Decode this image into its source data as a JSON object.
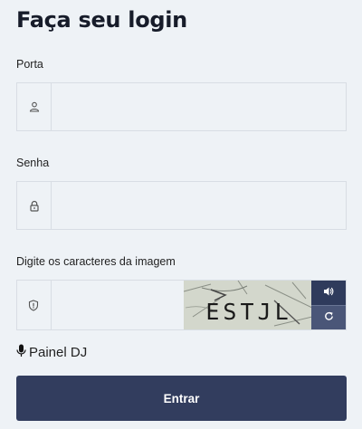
{
  "page": {
    "title": "Faça seu login"
  },
  "form": {
    "port": {
      "label": "Porta",
      "value": "",
      "icon": "user-icon"
    },
    "password": {
      "label": "Senha",
      "value": "",
      "icon": "lock-icon"
    },
    "captcha": {
      "label": "Digite os caracteres da imagem",
      "value": "",
      "icon": "shield-icon",
      "image_text": "ESTJL",
      "audio_icon": "speaker-icon",
      "refresh_icon": "refresh-icon"
    },
    "dj_link": {
      "label": "Painel DJ",
      "icon": "microphone-icon"
    },
    "submit_label": "Entrar"
  },
  "colors": {
    "background": "#eef2f6",
    "primary": "#323d5e",
    "border": "#d8dde4"
  }
}
